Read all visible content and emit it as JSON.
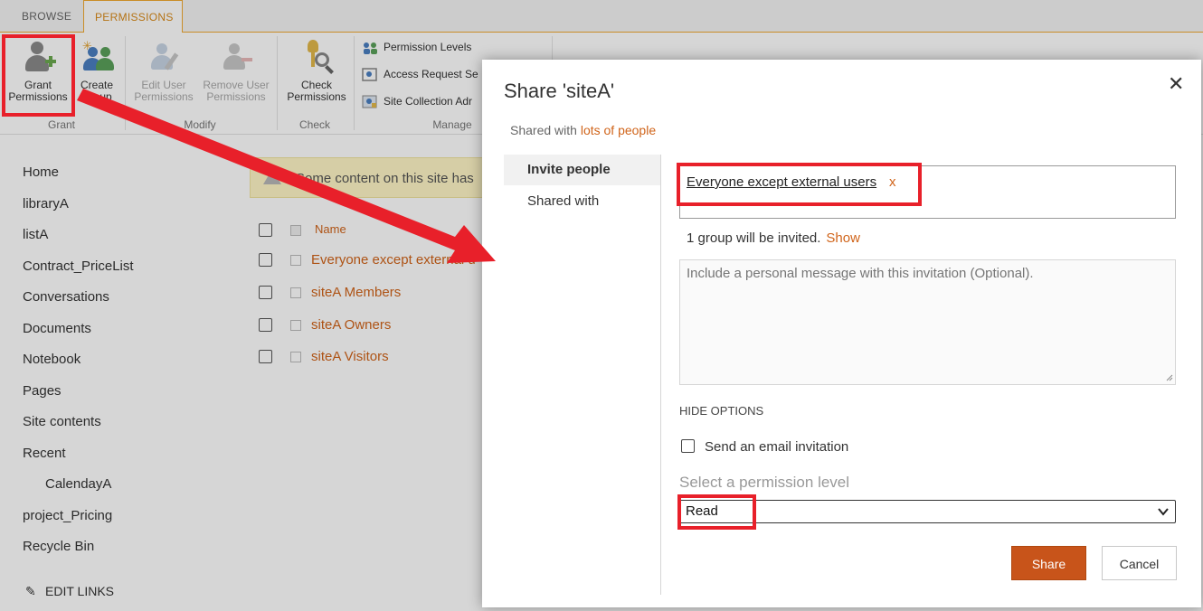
{
  "ribbon": {
    "tabs": [
      {
        "label": "BROWSE"
      },
      {
        "label": "PERMISSIONS"
      }
    ],
    "grant": {
      "grant_permissions_l1": "Grant",
      "grant_permissions_l2": "Permissions",
      "create_group_l1": "Create",
      "create_group_l2": "Group",
      "group_label": "Grant"
    },
    "modify": {
      "edit_user_l1": "Edit User",
      "edit_user_l2": "Permissions",
      "remove_user_l1": "Remove User",
      "remove_user_l2": "Permissions",
      "group_label": "Modify"
    },
    "check": {
      "check_l1": "Check",
      "check_l2": "Permissions",
      "group_label": "Check"
    },
    "manage": {
      "permission_levels": "Permission Levels",
      "access_request": "Access Request Se",
      "site_collection_admin": "Site Collection Adr",
      "group_label": "Manage"
    }
  },
  "nav": {
    "items": [
      {
        "label": "Home"
      },
      {
        "label": "libraryA"
      },
      {
        "label": "listA"
      },
      {
        "label": "Contract_PriceList"
      },
      {
        "label": "Conversations"
      },
      {
        "label": "Documents"
      },
      {
        "label": "Notebook"
      },
      {
        "label": "Pages"
      },
      {
        "label": "Site contents"
      },
      {
        "label": "Recent"
      },
      {
        "label": "CalendayA"
      },
      {
        "label": "project_Pricing"
      },
      {
        "label": "Recycle Bin"
      }
    ],
    "edit_links": "EDIT LINKS"
  },
  "main": {
    "notice": "Some content on this site has",
    "column_name": "Name",
    "groups": [
      {
        "label": "Everyone except external u"
      },
      {
        "label": "siteA Members"
      },
      {
        "label": "siteA Owners"
      },
      {
        "label": "siteA Visitors"
      }
    ]
  },
  "dialog": {
    "title": "Share 'siteA'",
    "close": "✕",
    "shared_with_prefix": "Shared with",
    "shared_with_link": "lots of people",
    "nav": [
      {
        "label": "Invite people"
      },
      {
        "label": "Shared with"
      }
    ],
    "people_chip": "Everyone except external users",
    "people_chip_remove": "x",
    "invite_count": "1 group will be invited.",
    "invite_show": "Show",
    "message_placeholder": "Include a personal message with this invitation (Optional).",
    "hide_options": "HIDE OPTIONS",
    "email_invitation": "Send an email invitation",
    "permission_label": "Select a permission level",
    "permission_value": "Read",
    "share_button": "Share",
    "cancel_button": "Cancel"
  },
  "colors": {
    "accent": "#d0641a",
    "share_button": "#c8541a",
    "annotation": "#e8202a",
    "notice_bg": "#fff6c6"
  }
}
